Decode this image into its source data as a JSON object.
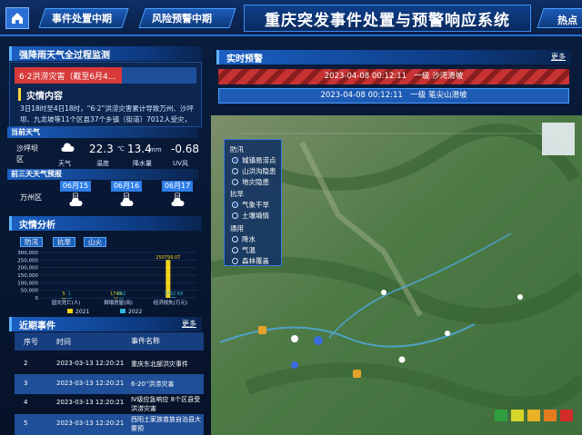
{
  "header": {
    "app_title": "重庆突发事件处置与预警响应系统",
    "tabs": [
      "事件处置中期",
      "风险预警中期"
    ],
    "right_tab": "热点"
  },
  "weather_panel": {
    "title": "强降雨天气全过程监测",
    "alert_label": "6·2洪涝灾害（截至6月4...",
    "disaster_info_title": "灾情内容",
    "disaster_info_text": "3日18时至4日18时，“6·2”洪涝灾害累计导致万州、沙坪坝、九龙坡等11个区县37个乡镇（街道）7012人受灾，某...",
    "current_weather_title": "当前天气",
    "location": "沙坪坝区",
    "temperature": "22.3",
    "temperature_unit": "℃",
    "rainfall": "13.4",
    "rainfall_unit": "mm",
    "uv": "-0.68",
    "labels": [
      "天气",
      "温度",
      "降水量",
      "UV风"
    ],
    "forecast_title": "前三天天气预报",
    "forecast_location": "万州区",
    "forecast_dates": [
      "06月15日",
      "06月16日",
      "06月17日"
    ]
  },
  "disaster_analysis": {
    "title": "灾情分析",
    "buttons": [
      "防汛",
      "抗旱",
      "山火"
    ],
    "chart_data": {
      "type": "bar",
      "categories": [
        "因灾死亡(人)",
        "倒塌房屋(间)",
        "经济损失(万元)"
      ],
      "series": [
        {
          "name": "2021",
          "values": [
            5,
            1749,
            250799.07
          ],
          "color": "#f2d21b"
        },
        {
          "name": "2022",
          "values": [
            1,
            292,
            3732.68
          ],
          "color": "#2fb5d9"
        }
      ],
      "data_labels": [
        "5",
        "1",
        "1749",
        "292",
        "250799.07",
        "3732.68"
      ],
      "yticks": [
        "300,000",
        "250,000",
        "200,000",
        "150,000",
        "100,000",
        "50,000",
        "0"
      ],
      "ylim": [
        0,
        300000
      ],
      "legend": "bottom"
    }
  },
  "recent_events": {
    "title": "近期事件",
    "more": "更多",
    "columns": [
      "序号",
      "时间",
      "事件名称"
    ],
    "rows": [
      {
        "no": "2",
        "time": "2023-03-13 12:20:21",
        "name": "重庆东北部洪灾事件",
        "hl": false
      },
      {
        "no": "3",
        "time": "2023-03-13 12:20:21",
        "name": "6-20”洪涝灾害",
        "hl": true
      },
      {
        "no": "4",
        "time": "2023-03-13 12:20:21",
        "name": "Ⅳ级应急响应 8个区县受洪涝灾害",
        "hl": false
      },
      {
        "no": "5",
        "time": "2023-03-13 12:20:21",
        "name": "西阳土家族苗族自治县大雾预",
        "hl": true
      }
    ]
  },
  "realtime_warning": {
    "title": "实时预警",
    "more": "更多",
    "items": [
      "2023-04-08 00:12:11　一级  沙湾滑坡",
      "2023-04-08 00:12:11　一级  笔尖山滑坡"
    ]
  },
  "map_layers": {
    "group1": "防汛",
    "group1_items": [
      "城镇易涝点",
      "山洪沟隐患",
      "地灾隐患"
    ],
    "group2": "抗旱",
    "group2_items": [
      "气象干旱",
      "土壤墒情"
    ],
    "group3": "通用",
    "group3_items": [
      "降水",
      "气温",
      "森林覆盖"
    ]
  },
  "colors": {
    "accent": "#1f6fd1",
    "warn_red": "#c73232",
    "legend": [
      "#2e9e3e",
      "#d6d62a",
      "#e8b126",
      "#e67a1f",
      "#d42b2b"
    ]
  }
}
